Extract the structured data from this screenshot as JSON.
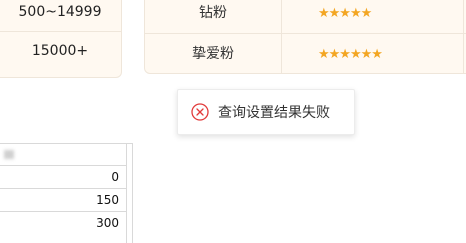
{
  "tiers_left": {
    "rows": [
      {
        "range": "500~14999"
      },
      {
        "range": "15000+"
      }
    ]
  },
  "tiers_right": {
    "rows": [
      {
        "level": "钻粉",
        "stars": "★★★★★"
      },
      {
        "level": "挚爱粉",
        "stars": "★★★★★★"
      }
    ],
    "star_color": "#f3a623"
  },
  "toast": {
    "icon": "error-circle-icon",
    "message": "查询设置结果失败",
    "icon_color": "#e23a3a"
  },
  "table": {
    "values": [
      "0",
      "150",
      "300"
    ]
  }
}
